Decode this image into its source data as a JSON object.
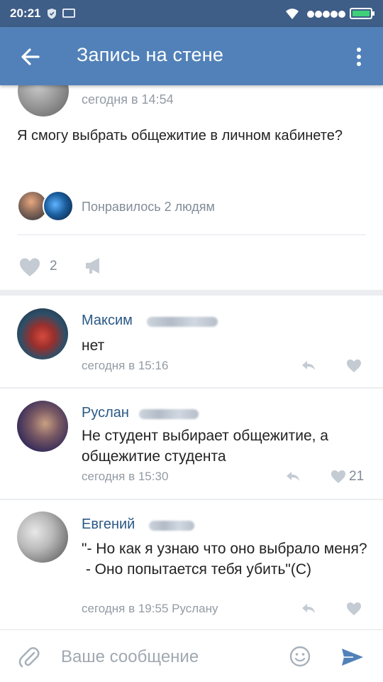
{
  "statusbar": {
    "time": "20:21"
  },
  "appbar": {
    "title": "Запись на стене"
  },
  "post": {
    "time": "сегодня в 14:54",
    "text": "Я смогу выбрать общежитие в личном кабинете?",
    "likers_text": "Понравилось 2 людям",
    "like_count": "2"
  },
  "comments": [
    {
      "name": "Максим",
      "text": "нет",
      "time": "сегодня в 15:16",
      "likes": ""
    },
    {
      "name": "Руслан",
      "text": "Не студент выбирает общежитие, а общежитие студента",
      "time": "сегодня в 15:30",
      "likes": "21"
    },
    {
      "name": "Евгений",
      "text_line1": "\"- Но как я узнаю что оно выбрало меня?",
      "text_line2": " - Оно попытается тебя убить\"(С)",
      "time": "сегодня в 19:55 Руслану",
      "likes": ""
    }
  ],
  "input": {
    "placeholder": "Ваше сообщение"
  },
  "colors": {
    "statusbar": "#3e5d87",
    "appbar": "#5181b8",
    "name_link": "#2a5885",
    "secondary_text": "#939ba4"
  }
}
